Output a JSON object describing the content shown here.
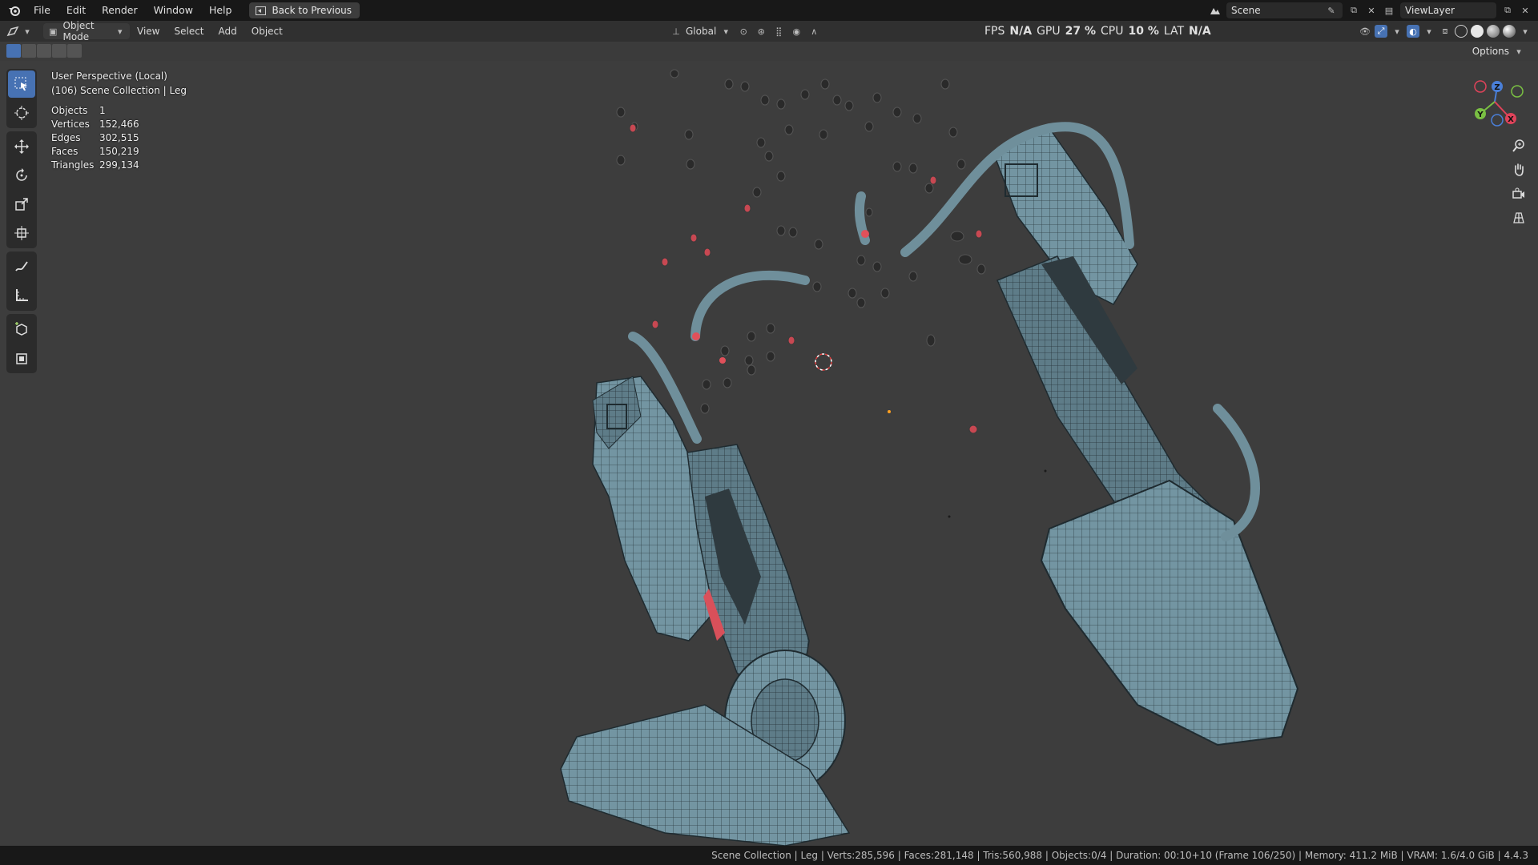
{
  "topbar": {
    "menus": [
      "File",
      "Edit",
      "Render",
      "Window",
      "Help"
    ],
    "back_label": "Back to Previous",
    "scene_name": "Scene",
    "view_layer": "ViewLayer"
  },
  "viewport_header": {
    "mode": "Object Mode",
    "menus": [
      "View",
      "Select",
      "Add",
      "Object"
    ],
    "orientation": "Global",
    "perf": {
      "fps_label": "FPS",
      "fps_value": "N/A",
      "gpu_label": "GPU",
      "gpu_value": "27 %",
      "cpu_label": "CPU",
      "cpu_value": "10 %",
      "lat_label": "LAT",
      "lat_value": "N/A"
    },
    "options_label": "Options"
  },
  "overlay": {
    "view_name": "User Perspective (Local)",
    "collection": "(106) Scene Collection | Leg",
    "stats": [
      {
        "label": "Objects",
        "value": "1"
      },
      {
        "label": "Vertices",
        "value": "152,466"
      },
      {
        "label": "Edges",
        "value": "302,515"
      },
      {
        "label": "Faces",
        "value": "150,219"
      },
      {
        "label": "Triangles",
        "value": "299,134"
      }
    ]
  },
  "gizmo": {
    "z": "Z",
    "y": "Y",
    "x": "X"
  },
  "statusbar": {
    "text": "Scene Collection | Leg | Verts:285,596 | Faces:281,148 | Tris:560,988 | Objects:0/4 | Duration: 00:10+10 (Frame 106/250) | Memory: 411.2 MiB | VRAM: 1.6/4.0 GiB | 4.4.3"
  },
  "colors": {
    "accent": "#4772b3",
    "mesh_fill": "#6f8f9b",
    "mesh_wire": "#2a3a40",
    "cap_red": "#e0505a",
    "viewport_bg": "#3d3d3d"
  }
}
